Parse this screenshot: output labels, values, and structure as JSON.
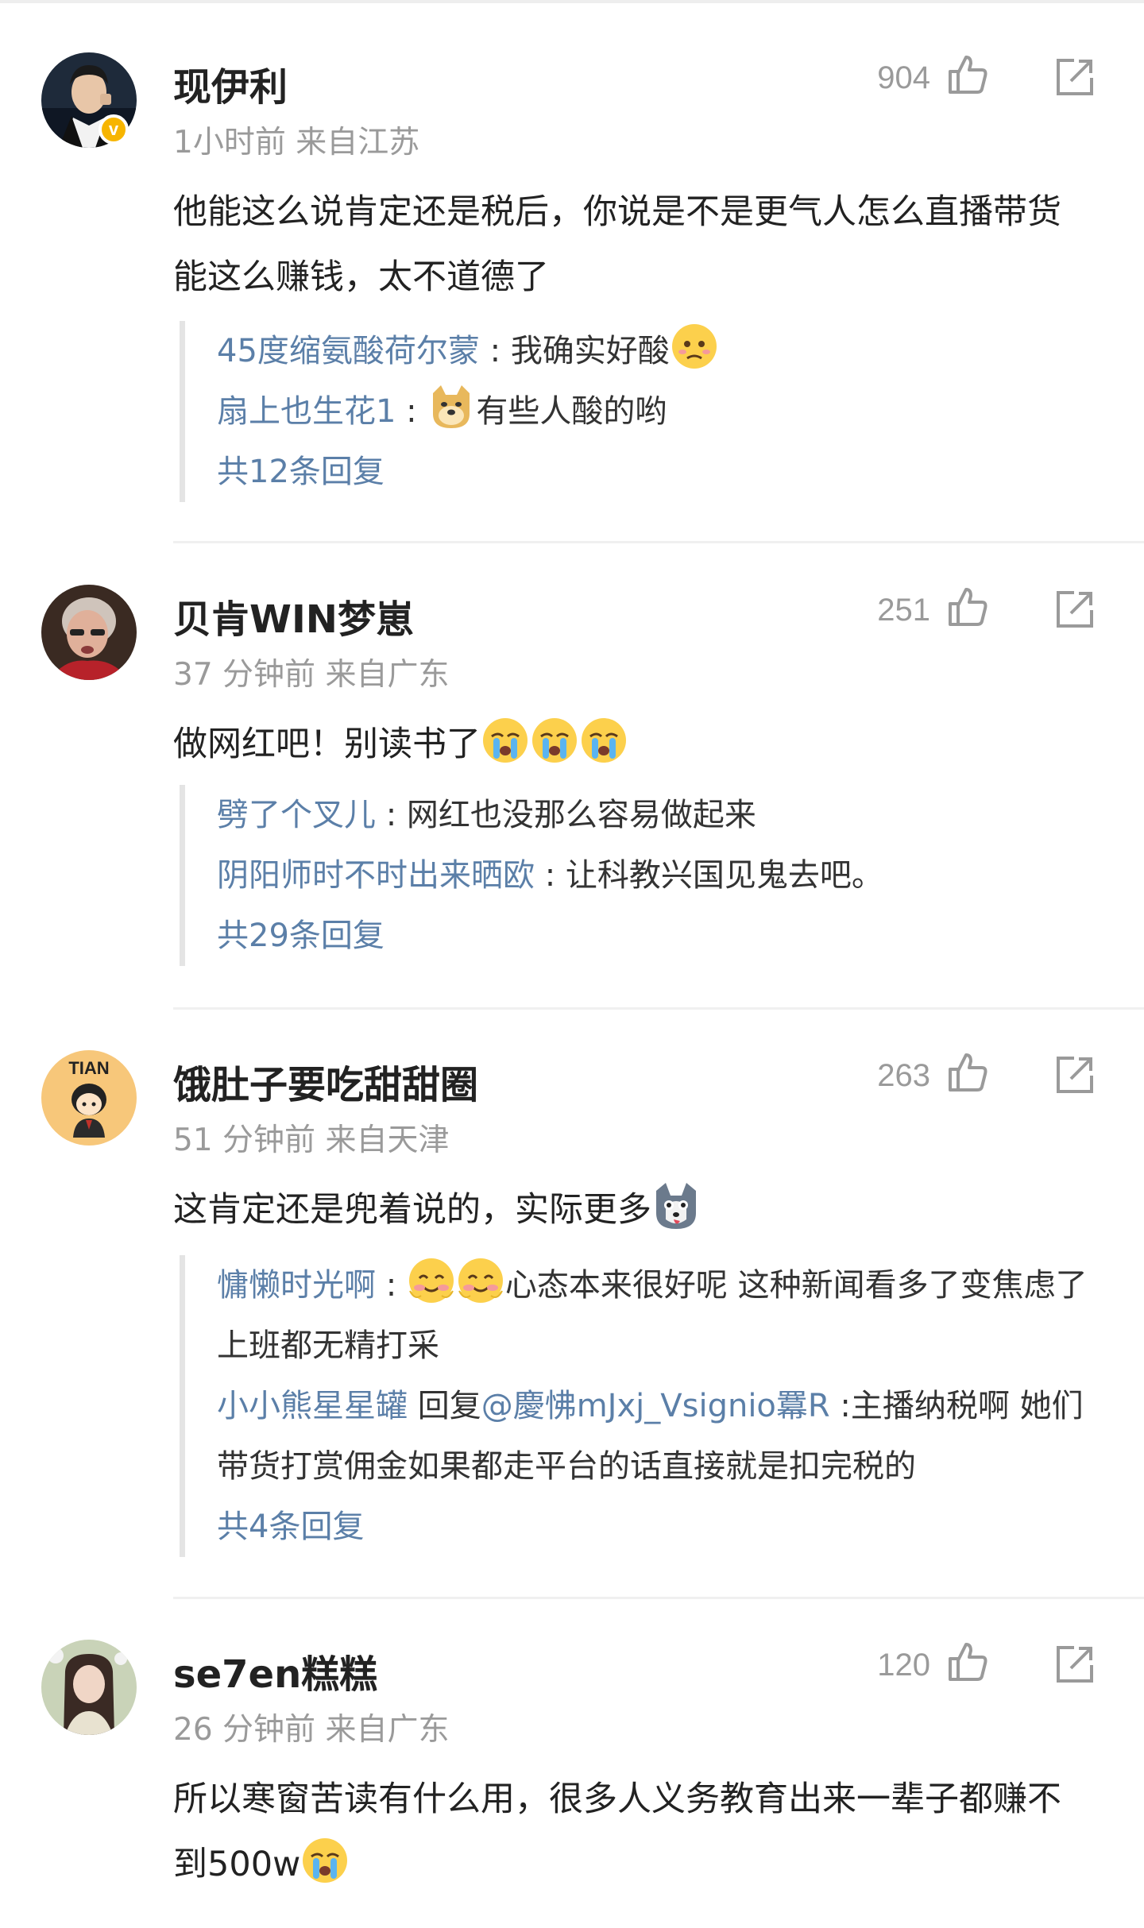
{
  "colors": {
    "link": "#5b7fa8",
    "meta": "#9a9a9a",
    "text": "#222222"
  },
  "comments": [
    {
      "user": "现伊利",
      "time": "1小时前",
      "location": "来自江苏",
      "likes": "904",
      "verified": true,
      "avatar": "avatar-man-suit",
      "content": "他能这么说肯定还是税后，你说是不是更气人怎么直播带货能这么赚钱，太不道德了",
      "replies": [
        {
          "user": "45度缩氨酸荷尔蒙",
          "sep": " : ",
          "text": "我确实好酸",
          "emoji_after": "sad-face"
        },
        {
          "user": "扇上也生花1",
          "sep": " : ",
          "emoji_before": "doge-face",
          "text": "有些人酸的哟"
        }
      ],
      "more": "共12条回复"
    },
    {
      "user": "贝肯WIN梦崽",
      "time": "37 分钟前",
      "location": "来自广东",
      "likes": "251",
      "avatar": "avatar-old-woman",
      "content": "做网红吧！别读书了",
      "content_emojis": [
        "crying-face",
        "crying-face",
        "crying-face"
      ],
      "replies": [
        {
          "user": "劈了个叉儿",
          "sep": " : ",
          "text": "网红也没那么容易做起来"
        },
        {
          "user": "阴阳师时不时出来晒欧",
          "sep": " : ",
          "text": "让科教兴国见鬼去吧。"
        }
      ],
      "more": "共29条回复"
    },
    {
      "user": "饿肚子要吃甜甜圈",
      "time": "51 分钟前",
      "location": "来自天津",
      "likes": "263",
      "avatar": "avatar-cartoon-tian",
      "avatar_text": "TIAN",
      "content": "这肯定还是兜着说的，实际更多",
      "content_emojis": [
        "husky-face"
      ],
      "replies": [
        {
          "user": "慵懒时光啊",
          "sep": " : ",
          "emoji_before2": "blush-face",
          "text": "心态本来很好呢 这种新闻看多了变焦虑了 上班都无精打采"
        },
        {
          "user": "小小熊星星罐",
          "reply_word": " 回复",
          "mention": "@慶怫mJxj_Vsignio羃R",
          "text": " :主播纳税啊 她们带货打赏佣金如果都走平台的话直接就是扣完税的"
        }
      ],
      "more": "共4条回复"
    },
    {
      "user": "se7en糕糕",
      "time": "26 分钟前",
      "location": "来自广东",
      "likes": "120",
      "avatar": "avatar-girl",
      "content": "所以寒窗苦读有什么用，很多人义务教育出来一辈子都赚不到500w",
      "content_emojis": [
        "crying-face"
      ]
    }
  ]
}
